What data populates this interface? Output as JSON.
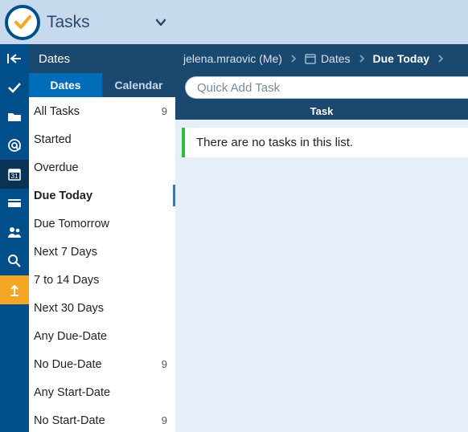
{
  "app": {
    "title": "Tasks"
  },
  "section": {
    "title": "Dates"
  },
  "tabs": {
    "dates": "Dates",
    "calendar": "Calendar"
  },
  "sidebar": {
    "items": [
      {
        "label": "All Tasks",
        "count": "9"
      },
      {
        "label": "Started",
        "count": ""
      },
      {
        "label": "Overdue",
        "count": ""
      },
      {
        "label": "Due Today",
        "count": ""
      },
      {
        "label": "Due Tomorrow",
        "count": ""
      },
      {
        "label": "Next 7 Days",
        "count": ""
      },
      {
        "label": "7 to 14 Days",
        "count": ""
      },
      {
        "label": "Next 30 Days",
        "count": ""
      },
      {
        "label": "Any Due-Date",
        "count": ""
      },
      {
        "label": "No Due-Date",
        "count": "9"
      },
      {
        "label": "Any Start-Date",
        "count": ""
      },
      {
        "label": "No Start-Date",
        "count": "9"
      }
    ]
  },
  "breadcrumbs": {
    "user": "jelena.mraovic (Me)",
    "mid": "Dates",
    "current": "Due Today"
  },
  "quickadd": {
    "placeholder": "Quick Add Task"
  },
  "columns": {
    "task": "Task"
  },
  "empty": {
    "message": "There are no tasks in this list."
  }
}
